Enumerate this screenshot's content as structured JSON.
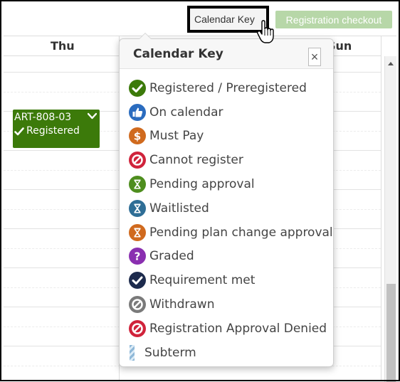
{
  "toolbar": {
    "calendar_key_label": "Calendar Key",
    "checkout_label": "Registration checkout"
  },
  "calendar": {
    "days": [
      "Thu",
      "Sun"
    ],
    "event": {
      "course": "ART-808-03",
      "status": "Registered",
      "color": "#3c7a0a"
    }
  },
  "popover": {
    "title": "Calendar Key",
    "close_symbol": "×",
    "items": [
      {
        "label": "Registered / Preregistered",
        "icon": "check-circle-icon",
        "color": "#3c7a0a"
      },
      {
        "label": "On calendar",
        "icon": "thumbs-up-icon",
        "color": "#2b6cbf"
      },
      {
        "label": "Must Pay",
        "icon": "dollar-icon",
        "color": "#d06a1e"
      },
      {
        "label": "Cannot register",
        "icon": "prohibited-icon",
        "color": "#d0233b"
      },
      {
        "label": "Pending approval",
        "icon": "hourglass-icon",
        "color": "#4e8e1e"
      },
      {
        "label": "Waitlisted",
        "icon": "hourglass-icon",
        "color": "#2f6e96"
      },
      {
        "label": "Pending plan change approval",
        "icon": "hourglass-icon",
        "color": "#d06a1e"
      },
      {
        "label": "Graded",
        "icon": "question-icon",
        "color": "#8a2fb0"
      },
      {
        "label": "Requirement met",
        "icon": "check-circle-icon",
        "color": "#1d2b4d"
      },
      {
        "label": "Withdrawn",
        "icon": "withdrawn-icon",
        "color": "#7a7a7a"
      },
      {
        "label": "Registration Approval Denied",
        "icon": "prohibited-icon",
        "color": "#d0233b"
      },
      {
        "label": "Subterm",
        "icon": "striped-swatch-icon",
        "color": "#8fb8d8"
      }
    ]
  }
}
